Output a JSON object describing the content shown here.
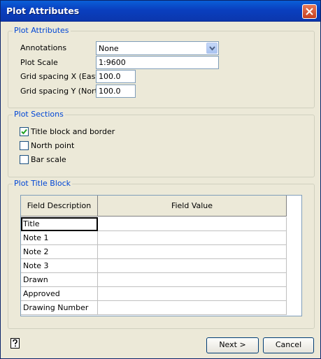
{
  "window": {
    "title": "Plot Attributes"
  },
  "plot_attributes": {
    "group_label": "Plot Attributes",
    "annotations_label": "Annotations",
    "annotations_value": "None",
    "plot_scale_label": "Plot Scale",
    "plot_scale_value": "1:9600",
    "grid_x_label": "Grid spacing X (East)",
    "grid_x_value": "100.0",
    "grid_y_label": "Grid spacing Y (North)",
    "grid_y_value": "100.0"
  },
  "plot_sections": {
    "group_label": "Plot Sections",
    "items": [
      {
        "label": "Title block and border",
        "checked": true
      },
      {
        "label": "North point",
        "checked": false
      },
      {
        "label": "Bar scale",
        "checked": false
      }
    ]
  },
  "title_block": {
    "group_label": "Plot Title Block",
    "columns": [
      "Field Description",
      "Field Value"
    ],
    "rows": [
      {
        "description": "Title",
        "value": ""
      },
      {
        "description": "Note 1",
        "value": ""
      },
      {
        "description": "Note 2",
        "value": ""
      },
      {
        "description": "Note 3",
        "value": ""
      },
      {
        "description": "Drawn",
        "value": ""
      },
      {
        "description": "Approved",
        "value": ""
      },
      {
        "description": "Drawing Number",
        "value": ""
      }
    ]
  },
  "buttons": {
    "next": "Next >",
    "cancel": "Cancel"
  },
  "icons": {
    "close": "close-icon",
    "dropdown": "chevron-down-icon",
    "help": "help-icon",
    "check": "checkmark-icon"
  },
  "colors": {
    "titlebar": "#0a3fbf",
    "group_label": "#0046d5",
    "dialog_bg": "#ece9d8"
  }
}
